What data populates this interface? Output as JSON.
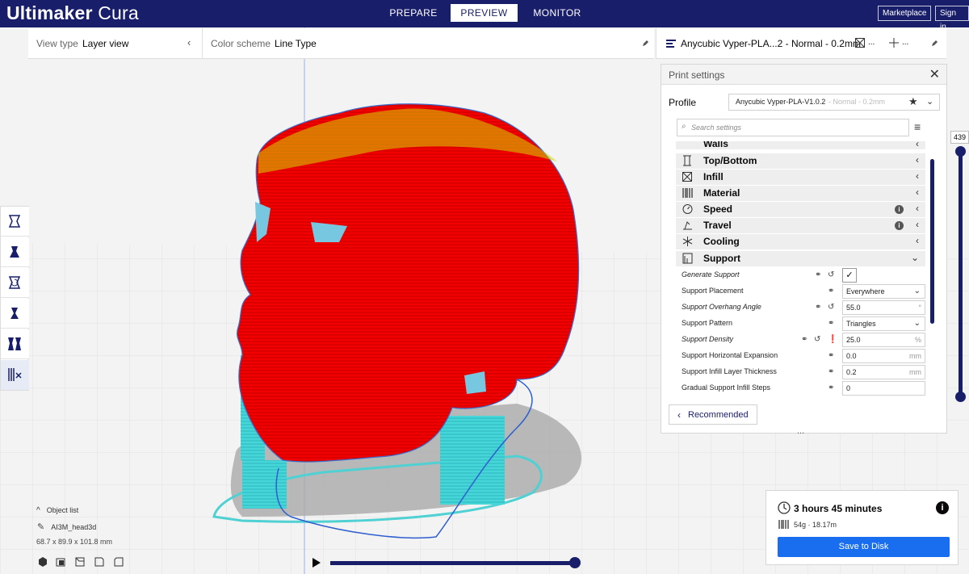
{
  "app": {
    "title_bold": "Ultimaker",
    "title_light": " Cura"
  },
  "stages": [
    {
      "label": "PREPARE"
    },
    {
      "label": "PREVIEW"
    },
    {
      "label": "MONITOR"
    }
  ],
  "top_buttons": {
    "marketplace": "Marketplace",
    "sign_in": "Sign in"
  },
  "view_bar": {
    "view_type_label": "View type",
    "view_type_value": "Layer view",
    "color_scheme_label": "Color scheme",
    "color_scheme_value": "Line Type"
  },
  "printer_bar": {
    "printer_label": "Anycubic Vyper-PLA...2 - Normal - 0.2mm",
    "ellipsis1": "...",
    "ellipsis2": "..."
  },
  "print_settings": {
    "title": "Print settings",
    "profile_label": "Profile",
    "profile_value": "Anycubic Vyper-PLA-V1.0.2",
    "profile_suffix": " - Normal - 0.2mm",
    "search_placeholder": "Search settings",
    "categories": [
      {
        "label": "Walls",
        "icon": "walls-icon"
      },
      {
        "label": "Top/Bottom",
        "icon": "top-bottom-icon"
      },
      {
        "label": "Infill",
        "icon": "infill-icon"
      },
      {
        "label": "Material",
        "icon": "material-icon"
      },
      {
        "label": "Speed",
        "icon": "speed-icon"
      },
      {
        "label": "Travel",
        "icon": "travel-icon"
      },
      {
        "label": "Cooling",
        "icon": "cooling-icon"
      },
      {
        "label": "Support",
        "icon": "support-icon"
      }
    ],
    "settings": [
      {
        "label": "Generate Support",
        "value": ""
      },
      {
        "label": "Support Placement",
        "value": "Everywhere"
      },
      {
        "label": "Support Overhang Angle",
        "value": "55.0",
        "unit": "°"
      },
      {
        "label": "Support Pattern",
        "value": "Triangles"
      },
      {
        "label": "Support Density",
        "value": "25.0",
        "unit": "%"
      },
      {
        "label": "Support Horizontal Expansion",
        "value": "0.0",
        "unit": "mm"
      },
      {
        "label": "Support Infill Layer Thickness",
        "value": "0.2",
        "unit": "mm"
      },
      {
        "label": "Gradual Support Infill Steps",
        "value": "0"
      }
    ],
    "recommended_label": "Recommended",
    "more_dots": "..."
  },
  "layer_slider": {
    "max_layer": "439"
  },
  "object_list": {
    "toggle_label": "Object list",
    "object_name": "AI3M_head3d",
    "dimensions": "68.7 x 89.9 x 101.8 mm"
  },
  "print_estimate": {
    "time": "3 hours 45 minutes",
    "material": "54g · 18.17m",
    "save_label": "Save to Disk"
  },
  "colors": {
    "header_bg": "#191e6a",
    "primary_button": "#196ef0",
    "model_red": "#ff0000",
    "support_cyan": "#54ccd6",
    "slider_track": "#191e6a"
  }
}
